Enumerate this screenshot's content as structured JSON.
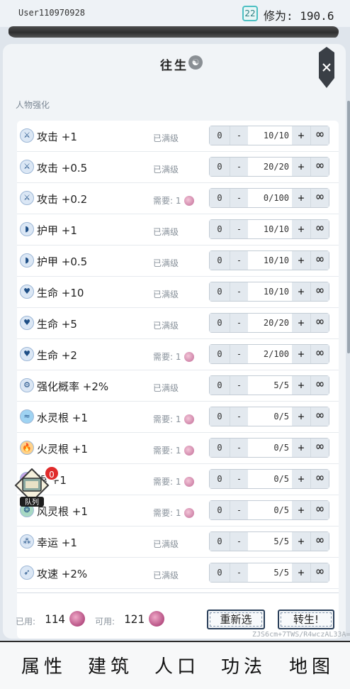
{
  "header": {
    "user": "User110970928",
    "level": "22",
    "cultivation_label": "修为:",
    "cultivation_value": "190.6"
  },
  "panel": {
    "title": "往生",
    "section_label": "人物强化"
  },
  "rows": [
    {
      "icon": "sword-icon",
      "name": "攻击 +1",
      "status": "已满级",
      "cost": "",
      "min": "0",
      "minus": "-",
      "value": "10/10",
      "plus": "+",
      "max": "∞"
    },
    {
      "icon": "sword-icon",
      "name": "攻击 +0.5",
      "status": "已满级",
      "cost": "",
      "min": "0",
      "minus": "-",
      "value": "20/20",
      "plus": "+",
      "max": "∞"
    },
    {
      "icon": "sword-icon",
      "name": "攻击 +0.2",
      "status": "需要:",
      "cost": "1",
      "min": "0",
      "minus": "-",
      "value": "0/100",
      "plus": "+",
      "max": "∞"
    },
    {
      "icon": "shield-icon",
      "name": "护甲 +1",
      "status": "已满级",
      "cost": "",
      "min": "0",
      "minus": "-",
      "value": "10/10",
      "plus": "+",
      "max": "∞"
    },
    {
      "icon": "shield-icon",
      "name": "护甲 +0.5",
      "status": "已满级",
      "cost": "",
      "min": "0",
      "minus": "-",
      "value": "10/10",
      "plus": "+",
      "max": "∞"
    },
    {
      "icon": "heart-icon",
      "name": "生命 +10",
      "status": "已满级",
      "cost": "",
      "min": "0",
      "minus": "-",
      "value": "10/10",
      "plus": "+",
      "max": "∞"
    },
    {
      "icon": "heart-icon",
      "name": "生命 +5",
      "status": "已满级",
      "cost": "",
      "min": "0",
      "minus": "-",
      "value": "20/20",
      "plus": "+",
      "max": "∞"
    },
    {
      "icon": "heart-icon",
      "name": "生命 +2",
      "status": "需要:",
      "cost": "1",
      "min": "0",
      "minus": "-",
      "value": "2/100",
      "plus": "+",
      "max": "∞"
    },
    {
      "icon": "enhance-icon",
      "name": "强化概率 +2%",
      "status": "已满级",
      "cost": "",
      "min": "0",
      "minus": "-",
      "value": "5/5",
      "plus": "+",
      "max": "∞"
    },
    {
      "icon": "water-icon",
      "name": "水灵根 +1",
      "status": "需要:",
      "cost": "1",
      "min": "0",
      "minus": "-",
      "value": "0/5",
      "plus": "+",
      "max": "∞"
    },
    {
      "icon": "fire-icon",
      "name": "火灵根 +1",
      "status": "需要:",
      "cost": "1",
      "min": "0",
      "minus": "-",
      "value": "0/5",
      "plus": "+",
      "max": "∞"
    },
    {
      "icon": "earth-icon",
      "name": "根 +1",
      "status": "需要:",
      "cost": "1",
      "min": "0",
      "minus": "-",
      "value": "0/5",
      "plus": "+",
      "max": "∞"
    },
    {
      "icon": "wind-icon",
      "name": "风灵根 +1",
      "status": "需要:",
      "cost": "1",
      "min": "0",
      "minus": "-",
      "value": "0/5",
      "plus": "+",
      "max": "∞"
    },
    {
      "icon": "luck-icon",
      "name": "幸运 +1",
      "status": "已满级",
      "cost": "",
      "min": "0",
      "minus": "-",
      "value": "5/5",
      "plus": "+",
      "max": "∞"
    },
    {
      "icon": "speed-icon",
      "name": "攻速 +2%",
      "status": "已满级",
      "cost": "",
      "min": "0",
      "minus": "-",
      "value": "5/5",
      "plus": "+",
      "max": "∞"
    }
  ],
  "team": {
    "label": "队列",
    "badge": "0"
  },
  "footer": {
    "used_label": "已用:",
    "used_value": "114",
    "avail_label": "可用:",
    "avail_value": "121",
    "reselect_label": "重新选",
    "reincarnate_label": "转生!",
    "watermark": "ZJS6cm+7TWS/R4wczAL33A=="
  },
  "nav": [
    "属性",
    "建筑",
    "人口",
    "功法",
    "地图"
  ]
}
